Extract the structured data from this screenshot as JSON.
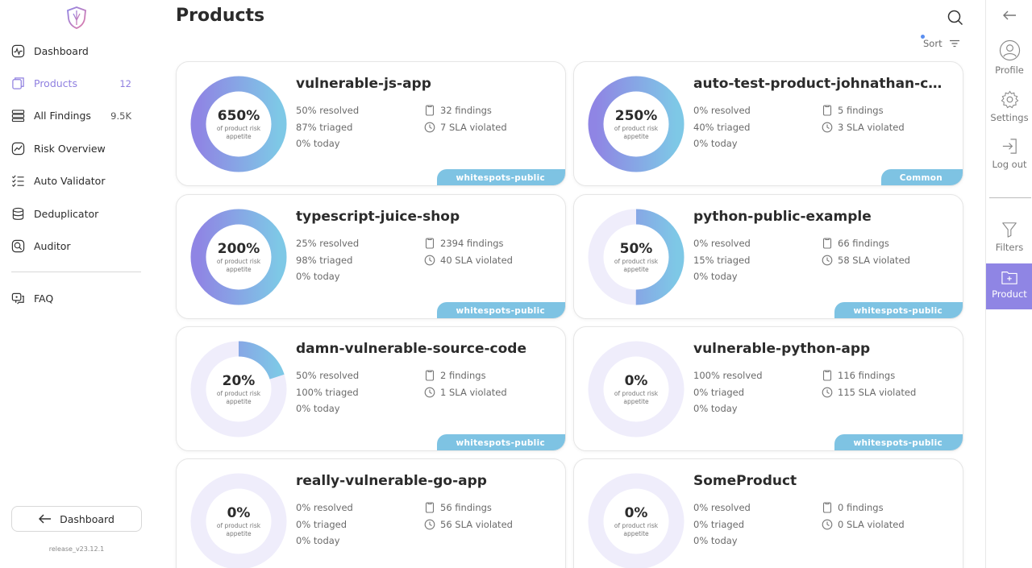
{
  "sidebar": {
    "items": [
      {
        "label": "Dashboard",
        "count": "",
        "icon": "dashboard-icon"
      },
      {
        "label": "Products",
        "count": "12",
        "icon": "products-icon",
        "active": true
      },
      {
        "label": "All Findings",
        "count": "9.5K",
        "icon": "findings-icon"
      },
      {
        "label": "Risk Overview",
        "count": "",
        "icon": "risk-overview-icon"
      },
      {
        "label": "Auto Validator",
        "count": "",
        "icon": "auto-validator-icon"
      },
      {
        "label": "Deduplicator",
        "count": "",
        "icon": "deduplicator-icon"
      },
      {
        "label": "Auditor",
        "count": "",
        "icon": "auditor-icon"
      }
    ],
    "faq": "FAQ",
    "back_button": "Dashboard",
    "release": "release_v23.12.1"
  },
  "header": {
    "title": "Products",
    "sort_label": "Sort"
  },
  "rail": {
    "profile": "Profile",
    "settings": "Settings",
    "logout": "Log out",
    "filters": "Filters",
    "product": "Product"
  },
  "colors": {
    "accent": "#8f7fe0",
    "tag": "#7ec3e3",
    "donut_start": "#8f85e4",
    "donut_end": "#7ec8e6",
    "donut_track": "#efedfb"
  },
  "donut_sub": "of product risk appetite",
  "products": [
    {
      "name": "vulnerable-js-app",
      "pct": "650%",
      "fill": 1.0,
      "resolved": "50%",
      "triaged": "87%",
      "today": "0%",
      "findings": "32 findings",
      "sla": "7 SLA violated",
      "tag": "whitespots-public"
    },
    {
      "name": "auto-test-product-johnathan-coffey",
      "pct": "250%",
      "fill": 1.0,
      "resolved": "0%",
      "triaged": "40%",
      "today": "0%",
      "findings": "5 findings",
      "sla": "3 SLA violated",
      "tag": "Common"
    },
    {
      "name": "typescript-juice-shop",
      "pct": "200%",
      "fill": 1.0,
      "resolved": "25%",
      "triaged": "98%",
      "today": "0%",
      "findings": "2394 findings",
      "sla": "40 SLA violated",
      "tag": "whitespots-public"
    },
    {
      "name": "python-public-example",
      "pct": "50%",
      "fill": 0.5,
      "resolved": "0%",
      "triaged": "15%",
      "today": "0%",
      "findings": "66 findings",
      "sla": "58 SLA violated",
      "tag": "whitespots-public"
    },
    {
      "name": "damn-vulnerable-source-code",
      "pct": "20%",
      "fill": 0.2,
      "resolved": "50%",
      "triaged": "100%",
      "today": "0%",
      "findings": "2 findings",
      "sla": "1 SLA violated",
      "tag": "whitespots-public"
    },
    {
      "name": "vulnerable-python-app",
      "pct": "0%",
      "fill": 0.0,
      "resolved": "100%",
      "triaged": "0%",
      "today": "0%",
      "findings": "116 findings",
      "sla": "115 SLA violated",
      "tag": "whitespots-public"
    },
    {
      "name": "really-vulnerable-go-app",
      "pct": "0%",
      "fill": 0.0,
      "resolved": "0%",
      "triaged": "0%",
      "today": "0%",
      "findings": "56 findings",
      "sla": "56 SLA violated",
      "tag": ""
    },
    {
      "name": "SomeProduct",
      "pct": "0%",
      "fill": 0.0,
      "resolved": "0%",
      "triaged": "0%",
      "today": "0%",
      "findings": "0 findings",
      "sla": "0 SLA violated",
      "tag": ""
    }
  ],
  "labels": {
    "resolved": "resolved",
    "triaged": "triaged",
    "today": "today"
  }
}
